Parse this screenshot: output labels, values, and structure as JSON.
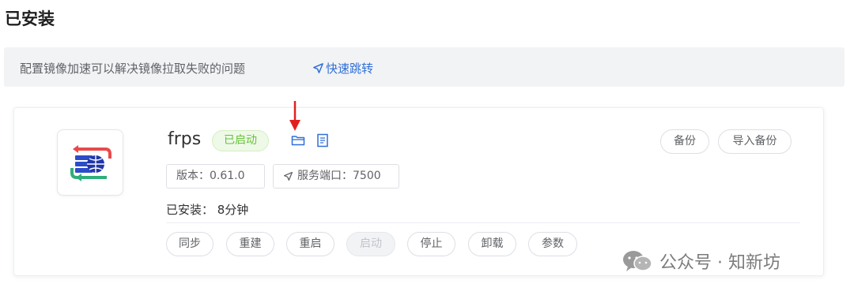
{
  "page": {
    "title": "已安装"
  },
  "notice": {
    "text": "配置镜像加速可以解决镜像拉取失败的问题",
    "link_label": "快速跳转",
    "link_color": "#2f6fd6"
  },
  "app": {
    "name": "frps",
    "status": "已启动",
    "status_color": "#67c23a",
    "version": "版本：0.61.0",
    "port": "服务端口：7500",
    "installed": "已安装：  8分钟",
    "icons": [
      "folder-icon",
      "document-icon"
    ]
  },
  "actions": {
    "sync": "同步",
    "rebuild": "重建",
    "restart": "重启",
    "start": "启动",
    "stop": "停止",
    "uninstall": "卸载",
    "params": "参数",
    "backup": "备份",
    "import_backup": "导入备份"
  },
  "watermark": {
    "text": "公众号 · 知新坊"
  }
}
